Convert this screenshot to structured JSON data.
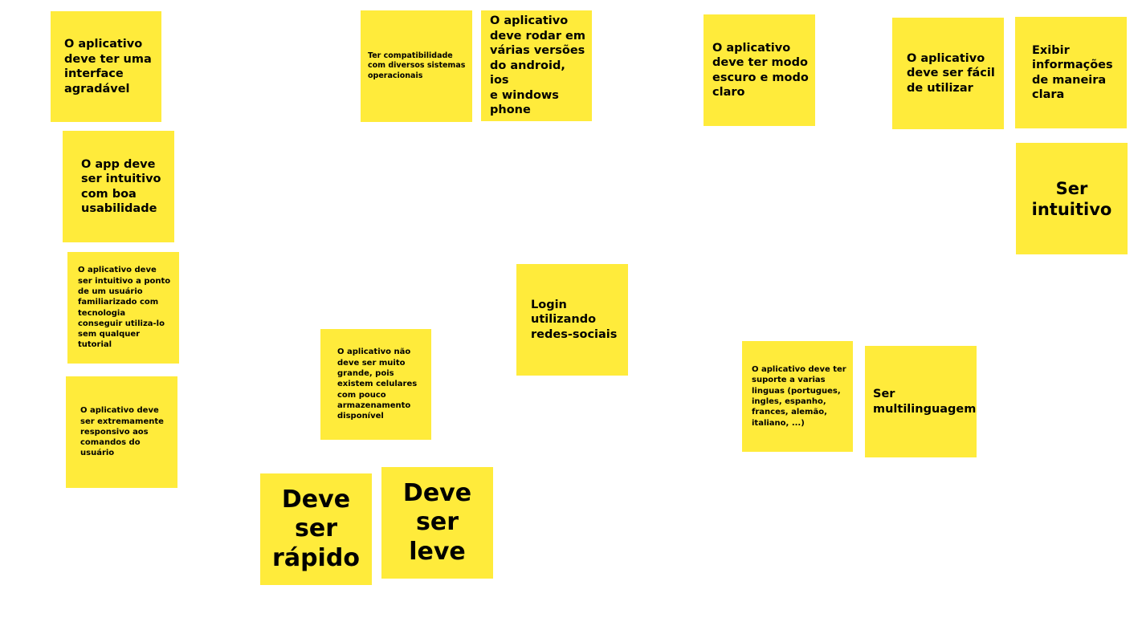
{
  "board": {
    "note_color": "#ffeb3b",
    "notes": [
      {
        "text": "O aplicativo\ndeve ter uma\ninterface\nagradável"
      },
      {
        "text": "Ter compatibilidade\ncom diversos sistemas\noperacionais"
      },
      {
        "text": "O aplicativo\ndeve rodar em\nvárias versões\ndo android, ios\ne windows\nphone"
      },
      {
        "text": "O aplicativo\ndeve ter modo\nescuro e modo\nclaro"
      },
      {
        "text": "O aplicativo\ndeve ser fácil\nde utilizar"
      },
      {
        "text": "Exibir\ninformações\nde maneira\nclara"
      },
      {
        "text": "O app deve\nser intuitivo\ncom boa\nusabilidade"
      },
      {
        "text": "Ser\nintuitivo"
      },
      {
        "text": "O aplicativo deve\nser intuitivo a ponto\nde um usuário\nfamiliarizado com\ntecnologia\nconseguir utiliza-lo\nsem qualquer\ntutorial"
      },
      {
        "text": "Login\nutilizando\nredes-sociais"
      },
      {
        "text": "O aplicativo não\ndeve ser muito\ngrande, pois\nexistem celulares\ncom pouco\narmazenamento\ndisponível"
      },
      {
        "text": "O aplicativo deve ter\nsuporte a varias\nlinguas (portugues,\ningles, espanho,\nfrances, alemão,\nitaliano, ...)"
      },
      {
        "text": "Ser\nmultilinguagem"
      },
      {
        "text": "O aplicativo deve\nser extremamente\nresponsivo aos\ncomandos do\nusuário"
      },
      {
        "text": "Deve\nser\nleve"
      },
      {
        "text": "Deve\nser\nrápido"
      }
    ]
  }
}
